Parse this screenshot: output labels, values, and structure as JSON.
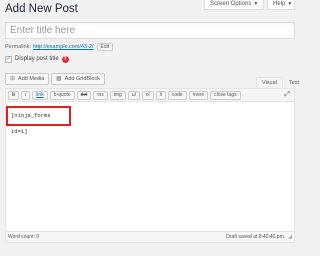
{
  "header": {
    "screen_options": "Screen Options",
    "help": "Help",
    "dropdown_glyph": "▼"
  },
  "page": {
    "title": "Add New Post"
  },
  "title_field": {
    "placeholder": "Enter title here",
    "value": ""
  },
  "permalink": {
    "label": "Permalink:",
    "url": "http://example.com/43-2/",
    "edit_label": "Edit"
  },
  "display_title": {
    "label": "Display post title",
    "checked": true,
    "check_glyph": "✓",
    "help_glyph": "?"
  },
  "media_buttons": [
    {
      "label": "Add Media",
      "icon": "media-icon",
      "glyph": "⊞"
    },
    {
      "label": "Add GridBlock",
      "icon": "grid-icon",
      "glyph": "▦"
    }
  ],
  "editor_tabs": [
    {
      "label": "Visual",
      "active": true
    },
    {
      "label": "Text",
      "active": false
    }
  ],
  "quicktags": [
    "b",
    "i",
    "link",
    "b-quote",
    "del",
    "ins",
    "img",
    "ul",
    "ol",
    "li",
    "code",
    "more",
    "close tags"
  ],
  "editor": {
    "content": "[ninja_forms id=1]",
    "fullscreen_glyph": "⤢"
  },
  "status": {
    "word_count": "Word count: 0",
    "draft_saved": "Draft saved at 8:40:40 pm.",
    "resize_glyph": "◢"
  }
}
